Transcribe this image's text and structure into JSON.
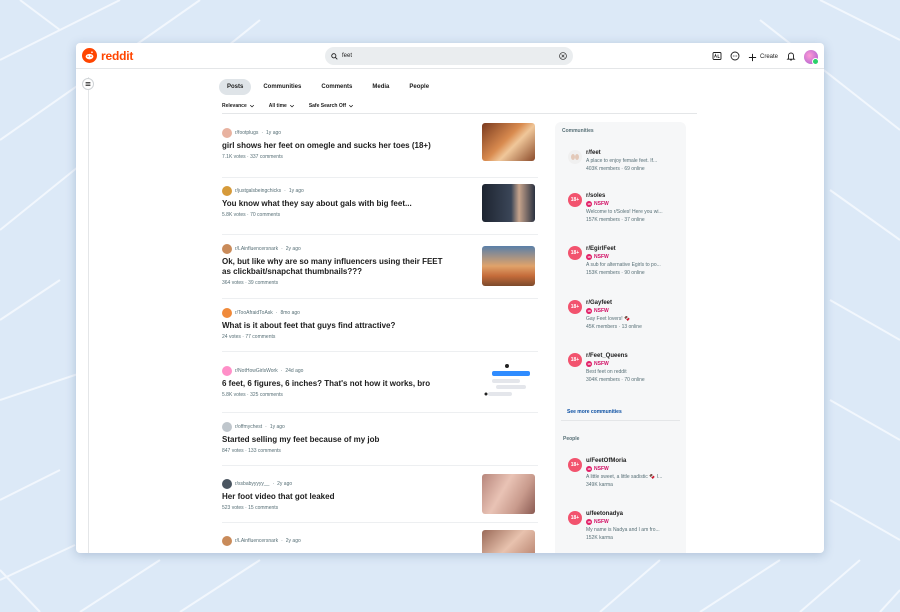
{
  "app": {
    "name": "reddit"
  },
  "search": {
    "value": "feet"
  },
  "header": {
    "create_label": "Create"
  },
  "tabs": [
    {
      "label": "Posts",
      "active": true
    },
    {
      "label": "Communities"
    },
    {
      "label": "Comments"
    },
    {
      "label": "Media"
    },
    {
      "label": "People"
    }
  ],
  "filters": [
    {
      "label": "Relevance"
    },
    {
      "label": "All time"
    },
    {
      "label": "Safe Search Off"
    }
  ],
  "posts": [
    {
      "sub": "r/footplugs",
      "age": "1y ago",
      "title_pre": "girl shows her ",
      "title_kw": "feet",
      "title_post": " on omegle and sucks her toes (18+)",
      "votes": "7.1K votes",
      "comments": "337 comments"
    },
    {
      "sub": "r/justgalsbeingchicks",
      "age": "1y ago",
      "title_pre": "You know what they say about gals with big ",
      "title_kw": "feet",
      "title_post": "...",
      "votes": "5.8K votes",
      "comments": "70 comments"
    },
    {
      "sub": "r/LAinfluencersnark",
      "age": "2y ago",
      "title_pre": "Ok, but like why are so many influencers using their ",
      "title_kw": "FEET",
      "title_post": " as clickbait/snapchat thumbnails???",
      "votes": "364 votes",
      "comments": "39 comments"
    },
    {
      "sub": "r/TooAfraidToAsk",
      "age": "8mo ago",
      "title_pre": "What is it about ",
      "title_kw": "feet",
      "title_post": " that guys find attractive?",
      "votes": "24 votes",
      "comments": "77 comments"
    },
    {
      "sub": "r/NotHowGirlsWork",
      "age": "24d ago",
      "title_pre": "6 ",
      "title_kw": "feet",
      "title_post": ", 6 figures, 6 inches? That's not how it works, bro",
      "votes": "5.8K votes",
      "comments": "325 comments"
    },
    {
      "sub": "r/offmychest",
      "age": "1y ago",
      "title_pre": "Started selling my ",
      "title_kw": "feet",
      "title_post": " because of my job",
      "votes": "847 votes",
      "comments": "133 comments"
    },
    {
      "sub": "r/ssbabyyyyy__",
      "age": "2y ago",
      "title_pre": "Her foot video that got leaked",
      "title_kw": "",
      "title_post": "",
      "votes": "523 votes",
      "comments": "15 comments"
    },
    {
      "sub": "r/LAinfluencersnark",
      "age": "2y ago",
      "title_pre": "",
      "title_kw": "",
      "title_post": "",
      "votes": "",
      "comments": ""
    }
  ],
  "sidebar": {
    "communities_heading": "Communities",
    "communities": [
      {
        "name": "r/feet",
        "nsfw": "",
        "desc": "A place to enjoy female feet. If...",
        "members": "403K members",
        "online": "69 online"
      },
      {
        "name": "r/soles",
        "nsfw": "NSFW",
        "desc": "Welcome to r/Soles! Here you wi...",
        "members": "157K members",
        "online": "37 online"
      },
      {
        "name": "r/EgirlFeet",
        "nsfw": "NSFW",
        "desc": "A sub for alternative Egirls to po...",
        "members": "153K members",
        "online": "90 online"
      },
      {
        "name": "r/Gayfeet",
        "nsfw": "NSFW",
        "desc": "Gay Feet lovers! 🍫",
        "members": "45K members",
        "online": "13 online"
      },
      {
        "name": "r/Feet_Queens",
        "nsfw": "NSFW",
        "desc": "Best feet on reddit",
        "members": "304K members",
        "online": "70 online"
      }
    ],
    "see_more": "See more communities",
    "people_heading": "People",
    "people": [
      {
        "name": "u/FeetOfMoria",
        "nsfw": "NSFW",
        "desc": "A little sweet, a little sadistic 🍫 I...",
        "karma": "349K karma"
      },
      {
        "name": "u/feetonadya",
        "nsfw": "NSFW",
        "desc": "My name is Nadya and I am fro...",
        "karma": "152K karma"
      }
    ]
  },
  "colors": {
    "brand": "#ff4500",
    "nsfw": "#e21f67",
    "link": "#0a4fa3"
  }
}
